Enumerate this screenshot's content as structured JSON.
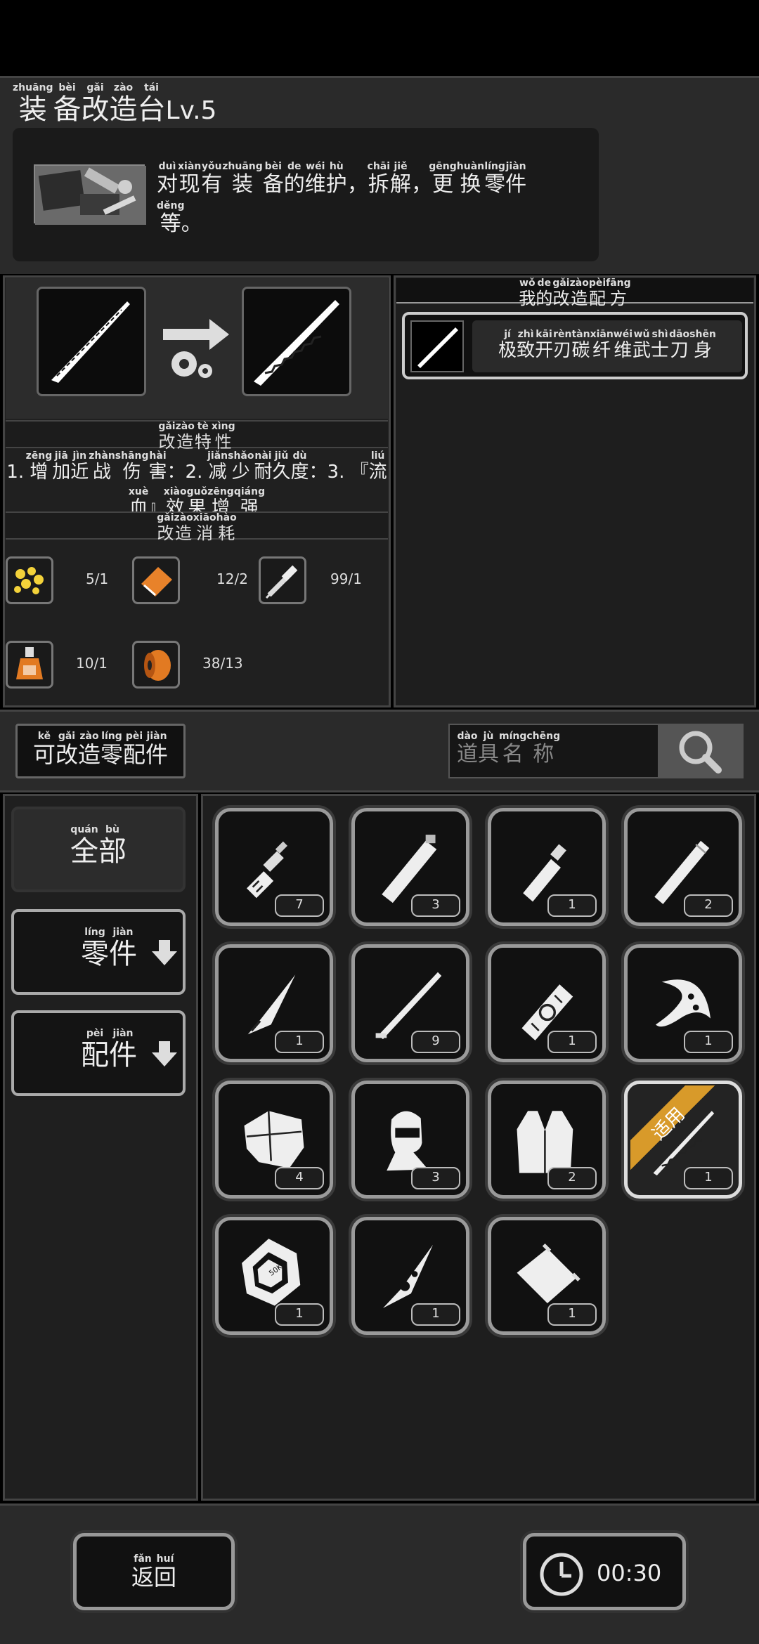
{
  "header": {
    "title_chars": [
      {
        "c": "装",
        "p": "zhuāng"
      },
      {
        "c": "备",
        "p": "bèi"
      },
      {
        "c": "改",
        "p": "gǎi"
      },
      {
        "c": "造",
        "p": "zào"
      },
      {
        "c": "台",
        "p": "tái"
      }
    ],
    "level": "Lv.5",
    "desc_line1": [
      {
        "c": "对",
        "p": "duì"
      },
      {
        "c": "现",
        "p": "xiàn"
      },
      {
        "c": "有",
        "p": "yǒu"
      },
      {
        "c": "装",
        "p": "zhuāng"
      },
      {
        "c": "备",
        "p": "bèi"
      },
      {
        "c": "的",
        "p": "de"
      },
      {
        "c": "维",
        "p": "wéi"
      },
      {
        "c": "护",
        "p": "hù"
      },
      {
        "c": "，",
        "p": ""
      },
      {
        "c": "拆",
        "p": "chāi"
      },
      {
        "c": "解",
        "p": "jiě"
      },
      {
        "c": "，",
        "p": ""
      },
      {
        "c": "更",
        "p": "gēng"
      },
      {
        "c": "换",
        "p": "huàn"
      },
      {
        "c": "零",
        "p": "líng"
      },
      {
        "c": "件",
        "p": "jiàn"
      }
    ],
    "desc_line2": [
      {
        "c": "等",
        "p": "děng"
      },
      {
        "c": "。",
        "p": ""
      }
    ]
  },
  "recipes": {
    "title": [
      {
        "c": "我",
        "p": "wǒ"
      },
      {
        "c": "的",
        "p": "de"
      },
      {
        "c": "改",
        "p": "gǎi"
      },
      {
        "c": "造",
        "p": "zào"
      },
      {
        "c": "配",
        "p": "pèi"
      },
      {
        "c": "方",
        "p": "fāng"
      }
    ],
    "item_name": [
      {
        "c": "极",
        "p": "jí"
      },
      {
        "c": "致",
        "p": "zhì"
      },
      {
        "c": "开",
        "p": "kāi"
      },
      {
        "c": "刃",
        "p": "rèn"
      },
      {
        "c": "碳",
        "p": "tàn"
      },
      {
        "c": "纤",
        "p": "xiān"
      },
      {
        "c": "维",
        "p": "wéi"
      },
      {
        "c": "武",
        "p": "wǔ"
      },
      {
        "c": "士",
        "p": "shì"
      },
      {
        "c": "刀",
        "p": "dāo"
      },
      {
        "c": "身",
        "p": "shēn"
      }
    ]
  },
  "traits": {
    "title": [
      {
        "c": "改",
        "p": "gǎi"
      },
      {
        "c": "造",
        "p": "zào"
      },
      {
        "c": "特",
        "p": "tè"
      },
      {
        "c": "性",
        "p": "xìng"
      }
    ],
    "line1": [
      {
        "c": "1. ",
        "p": ""
      },
      {
        "c": "增",
        "p": "zēng"
      },
      {
        "c": "加",
        "p": "jiā"
      },
      {
        "c": "近",
        "p": "jìn"
      },
      {
        "c": "战",
        "p": "zhàn"
      },
      {
        "c": "伤",
        "p": "shāng"
      },
      {
        "c": "害",
        "p": "hài"
      },
      {
        "c": "：2. ",
        "p": ""
      },
      {
        "c": "减",
        "p": "jiǎn"
      },
      {
        "c": "少",
        "p": "shǎo"
      },
      {
        "c": "耐",
        "p": "nài"
      },
      {
        "c": "久",
        "p": "jiǔ"
      },
      {
        "c": "度",
        "p": "dù"
      },
      {
        "c": "：3. 『",
        "p": ""
      },
      {
        "c": "流",
        "p": "liú"
      }
    ],
    "line2": [
      {
        "c": "血",
        "p": "xuè"
      },
      {
        "c": "』",
        "p": ""
      },
      {
        "c": "效",
        "p": "xiào"
      },
      {
        "c": "果",
        "p": "guǒ"
      },
      {
        "c": "增",
        "p": "zēng"
      },
      {
        "c": "强",
        "p": "qiáng"
      }
    ]
  },
  "costs": {
    "title": [
      {
        "c": "改",
        "p": "gǎi"
      },
      {
        "c": "造",
        "p": "zào"
      },
      {
        "c": "消",
        "p": "xiāo"
      },
      {
        "c": "耗",
        "p": "hào"
      }
    ],
    "items": [
      {
        "icon": "gold-nuggets-icon",
        "value": "5/1"
      },
      {
        "icon": "orange-book-icon",
        "value": "12/2"
      },
      {
        "icon": "syringe-tool-icon",
        "value": "99/1"
      },
      {
        "icon": "potion-bottle-icon",
        "value": "10/1"
      },
      {
        "icon": "orange-spool-icon",
        "value": "38/13"
      }
    ]
  },
  "filter": {
    "label": [
      {
        "c": "可",
        "p": "kě"
      },
      {
        "c": "改",
        "p": "gǎi"
      },
      {
        "c": "造",
        "p": "zào"
      },
      {
        "c": "零",
        "p": "líng"
      },
      {
        "c": "配",
        "p": "pèi"
      },
      {
        "c": "件",
        "p": "jiàn"
      }
    ],
    "search_placeholder": [
      {
        "c": "道",
        "p": "dào"
      },
      {
        "c": "具",
        "p": "jù"
      },
      {
        "c": "名",
        "p": "míng"
      },
      {
        "c": "称",
        "p": "chēng"
      }
    ]
  },
  "categories": [
    {
      "label": [
        {
          "c": "全",
          "p": "quán"
        },
        {
          "c": "部",
          "p": "bù"
        }
      ],
      "arrow": false
    },
    {
      "label": [
        {
          "c": "零",
          "p": "líng"
        },
        {
          "c": "件",
          "p": "jiàn"
        }
      ],
      "arrow": true
    },
    {
      "label": [
        {
          "c": "配",
          "p": "pèi"
        },
        {
          "c": "件",
          "p": "jiàn"
        }
      ],
      "arrow": true
    }
  ],
  "inventory": [
    {
      "icon": "handle-icon",
      "count": "7"
    },
    {
      "icon": "tube-icon",
      "count": "3"
    },
    {
      "icon": "short-tube-icon",
      "count": "1"
    },
    {
      "icon": "long-tube-icon",
      "count": "2"
    },
    {
      "icon": "dagger-blade-icon",
      "count": "1"
    },
    {
      "icon": "katana-icon",
      "count": "9"
    },
    {
      "icon": "wrapped-hilt-icon",
      "count": "1"
    },
    {
      "icon": "crescent-guard-icon",
      "count": "1"
    },
    {
      "icon": "armor-plate-icon",
      "count": "4"
    },
    {
      "icon": "balaclava-icon",
      "count": "3"
    },
    {
      "icon": "vest-icon",
      "count": "2"
    },
    {
      "icon": "serrated-blade-icon",
      "count": "1",
      "badge": "适用"
    },
    {
      "icon": "weight-plate-icon",
      "count": "1"
    },
    {
      "icon": "ornate-dagger-icon",
      "count": "1"
    },
    {
      "icon": "canister-icon",
      "count": "1"
    }
  ],
  "weight_label": "50KG",
  "footer": {
    "back": [
      {
        "c": "返",
        "p": "fǎn"
      },
      {
        "c": "回",
        "p": "huí"
      }
    ],
    "timer": "00:30"
  },
  "colors": {
    "accent_gold": "#d89a2a",
    "panel": "#2a2a2a",
    "frame": "#999999"
  }
}
